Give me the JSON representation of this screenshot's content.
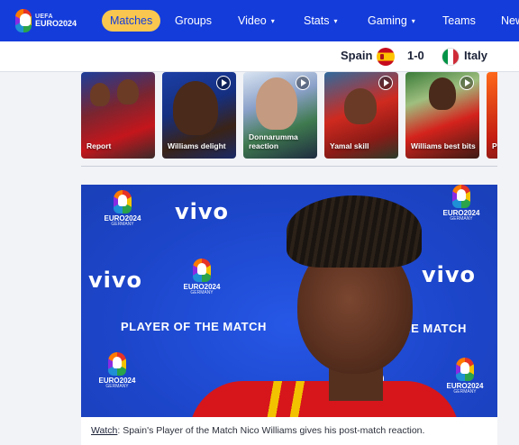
{
  "nav": {
    "logo": {
      "line1": "UEFA",
      "line2": "EURO2024"
    },
    "items": [
      {
        "label": "Matches",
        "active": true,
        "dropdown": false
      },
      {
        "label": "Groups",
        "active": false,
        "dropdown": false
      },
      {
        "label": "Video",
        "active": false,
        "dropdown": true
      },
      {
        "label": "Stats",
        "active": false,
        "dropdown": true
      },
      {
        "label": "Gaming",
        "active": false,
        "dropdown": true
      },
      {
        "label": "Teams",
        "active": false,
        "dropdown": false
      },
      {
        "label": "New",
        "active": false,
        "dropdown": false
      }
    ],
    "caret": "▾"
  },
  "scorebar": {
    "home_team": "Spain",
    "away_team": "Italy",
    "score": "1-0",
    "home_flag_icon": "spain-flag-icon",
    "away_flag_icon": "italy-flag-icon"
  },
  "carousel": {
    "items": [
      {
        "label": "Report",
        "has_play": false
      },
      {
        "label": "Williams delight",
        "has_play": true
      },
      {
        "label": "Donnarumma reaction",
        "has_play": true
      },
      {
        "label": "Yamal skill",
        "has_play": true
      },
      {
        "label": "Williams best bits",
        "has_play": true
      },
      {
        "label": "Pe",
        "has_play": false
      }
    ]
  },
  "video": {
    "sponsor": "vivo",
    "backdrop_text": "PLAYER OF THE MATCH",
    "badge_title": "EURO2024",
    "badge_sub": "GERMANY"
  },
  "caption": {
    "link": "Watch",
    "text": ": Spain's Player of the Match Nico Williams gives his post-match reaction."
  },
  "colors": {
    "nav_bg": "#143cdb",
    "active_pill": "#f9c74f",
    "page_bg": "#f1f3f6",
    "video_bg": "#1c4ed8"
  }
}
